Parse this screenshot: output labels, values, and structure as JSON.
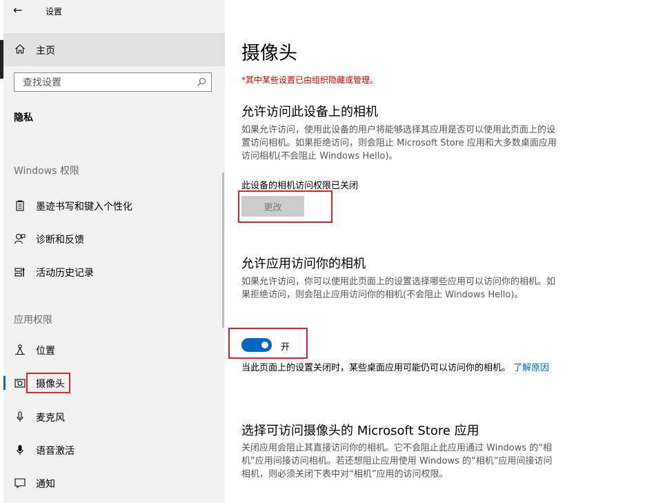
{
  "window": {
    "app_title": "设置"
  },
  "sidebar": {
    "home_label": "主页",
    "search_placeholder": "查找设置",
    "section_title": "隐私",
    "group_windows": "Windows 权限",
    "group_apps": "应用权限",
    "windows_items": [
      {
        "label": "墨迹书写和键入个性化",
        "icon": "notepad-icon"
      },
      {
        "label": "诊断和反馈",
        "icon": "feedback-person-icon"
      },
      {
        "label": "活动历史记录",
        "icon": "activity-history-icon"
      }
    ],
    "app_items": [
      {
        "label": "位置",
        "icon": "location-icon"
      },
      {
        "label": "摄像头",
        "icon": "camera-icon",
        "active": true
      },
      {
        "label": "麦克风",
        "icon": "microphone-icon"
      },
      {
        "label": "语音激活",
        "icon": "voice-microphone-icon"
      },
      {
        "label": "通知",
        "icon": "notification-icon"
      }
    ]
  },
  "main": {
    "title": "摄像头",
    "managed_notice": "*其中某些设置已由组织隐藏或管理。",
    "device_access": {
      "heading": "允许访问此设备上的相机",
      "description": "如果允许访问，使用此设备的用户将能够选择其应用是否可以使用此页面上的设置访问相机。如果拒绝访问，则会阻止 Microsoft Store 应用和大多数桌面应用访问相机(不会阻止 Windows Hello)。",
      "status": "此设备的相机访问权限已关闭",
      "change_button": "更改"
    },
    "app_access": {
      "heading": "允许应用访问你的相机",
      "description": "如果允许访问，你可以使用此页面上的设置选择哪些应用可以访问你的相机。如果拒绝访问，则会阻止应用访问你的相机(不会阻止 Windows Hello)。",
      "toggle_state": "开",
      "toggle_on": true,
      "note": "当此页面上的设置关闭时，某些桌面应用可能仍可以访问你的相机。",
      "note_link": "了解原因"
    },
    "store_apps": {
      "heading": "选择可访问摄像头的 Microsoft Store 应用",
      "description": "关闭应用会阻止其直接访问你的相机。它不会阻止此应用通过 Windows 的“相机”应用间接访问相机。若还想阻止应用使用 Windows 的“相机”应用间接访问相机，则必须关闭下表中对“相机”应用的访问权限。"
    }
  },
  "colors": {
    "accent": "#0067c0",
    "highlight_box": "#e0202a",
    "notice": "#d20000"
  }
}
